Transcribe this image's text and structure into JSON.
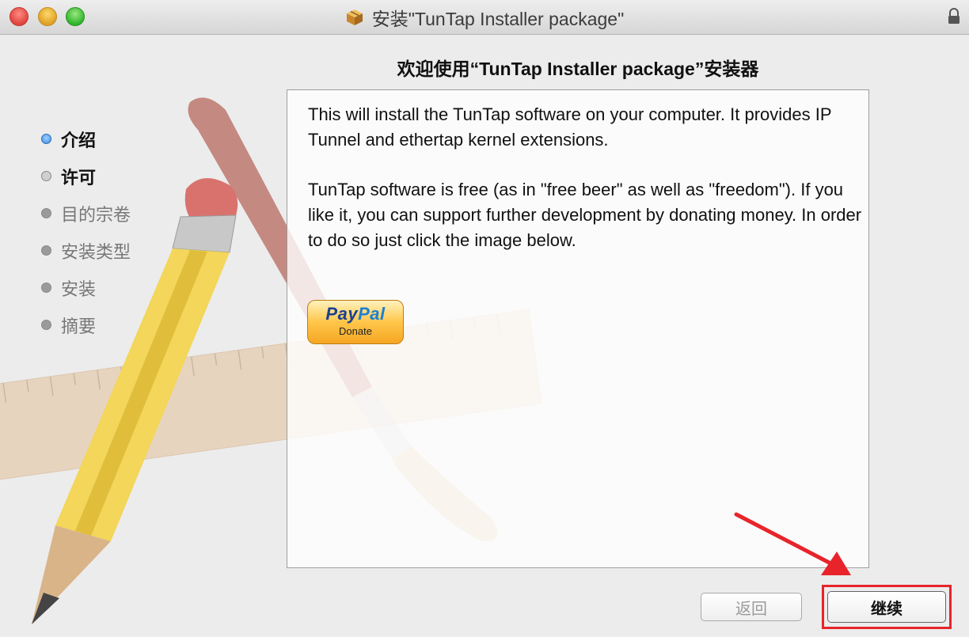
{
  "window": {
    "title": "安装\"TunTap Installer package\""
  },
  "heading": "欢迎使用“TunTap Installer package”安装器",
  "steps": [
    {
      "label": "介绍",
      "state": "current"
    },
    {
      "label": "许可",
      "state": "done"
    },
    {
      "label": "目的宗卷",
      "state": "pending"
    },
    {
      "label": "安装类型",
      "state": "pending"
    },
    {
      "label": "安装",
      "state": "pending"
    },
    {
      "label": "摘要",
      "state": "pending"
    }
  ],
  "content": {
    "paragraph1": "This will install the TunTap software on your computer. It provides IP Tunnel and ethertap kernel extensions.",
    "paragraph2": "TunTap software is free (as in \"free beer\" as well as \"freedom\"). If you like it, you can support further development by donating money. In order to do so just click the image below.",
    "paypal": {
      "pay": "Pay",
      "pal": "Pal",
      "donate": "Donate"
    }
  },
  "buttons": {
    "back": "返回",
    "continue": "继续"
  },
  "colors": {
    "highlight": "#e8242a",
    "step_current": "#3b8be0"
  },
  "icons": [
    "package-icon",
    "lock-icon",
    "paypal-donate-button",
    "annotation-arrow"
  ]
}
